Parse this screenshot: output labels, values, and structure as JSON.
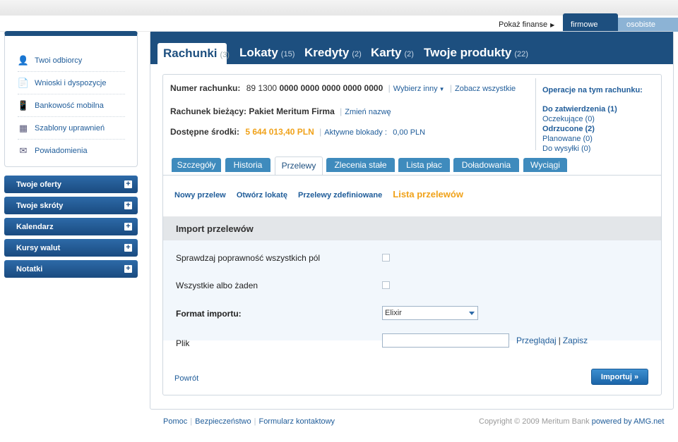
{
  "header": {
    "show_finance": "Pokaż finanse",
    "tab_business": "firmowe",
    "tab_private": "osobiste"
  },
  "sidebar": {
    "items": [
      {
        "label": "Twoi odbiorcy",
        "icon": "person-icon"
      },
      {
        "label": "Wnioski i dyspozycje",
        "icon": "document-icon"
      },
      {
        "label": "Bankowość mobilna",
        "icon": "mobile-phone-icon"
      },
      {
        "label": "Szablony uprawnień",
        "icon": "org-chart-icon"
      },
      {
        "label": "Powiadomienia",
        "icon": "notification-icon"
      }
    ],
    "accordions": [
      {
        "label": "Twoje oferty"
      },
      {
        "label": "Twoje skróty"
      },
      {
        "label": "Kalendarz"
      },
      {
        "label": "Kursy walut"
      },
      {
        "label": "Notatki"
      }
    ]
  },
  "main_tabs": [
    {
      "label": "Rachunki",
      "count": "(3)"
    },
    {
      "label": "Lokaty",
      "count": "(15)"
    },
    {
      "label": "Kredyty",
      "count": "(2)"
    },
    {
      "label": "Karty",
      "count": "(2)"
    },
    {
      "label": "Twoje produkty",
      "count": "(22)"
    }
  ],
  "account": {
    "number_label": "Numer rachunku:",
    "number_prefix": "89 1300",
    "number_rest": "0000 0000 0000 0000 0000",
    "choose_other": "Wybierz inny",
    "see_all": "Zobacz wszystkie",
    "type_label": "Rachunek bieżący: Pakiet Meritum Firma",
    "rename": "Zmień nazwę",
    "funds_label": "Dostępne środki:",
    "funds_value": "5 644 013,40 PLN",
    "blocks_label": "Aktywne blokady :",
    "blocks_value": "0,00 PLN"
  },
  "operations": {
    "title": "Operacje na tym rachunku:",
    "items": [
      {
        "label": "Do zatwierdzenia (1)",
        "bold": true
      },
      {
        "label": "Oczekujące (0)",
        "bold": false
      },
      {
        "label": "Odrzucone (2)",
        "bold": true
      },
      {
        "label": "Planowane (0)",
        "bold": false
      },
      {
        "label": "Do wysyłki (0)",
        "bold": false
      }
    ]
  },
  "subtabs": [
    "Szczegóły",
    "Historia",
    "Przelewy",
    "Zlecenia stałe",
    "Lista płac",
    "Doładowania",
    "Wyciągi"
  ],
  "actions": [
    "Nowy przelew",
    "Otwórz lokatę",
    "Przelewy zdefiniowane",
    "Lista przelewów"
  ],
  "import": {
    "title": "Import przelewów",
    "check_all": "Sprawdzaj poprawność wszystkich pól",
    "all_or_none": "Wszystkie albo żaden",
    "format_label": "Format importu:",
    "format_value": "Elixir",
    "file_label": "Plik",
    "browse": "Przeglądaj",
    "pipe": "|",
    "save": "Zapisz",
    "back": "Powrót",
    "import_btn": "Importuj »"
  },
  "footer": {
    "help": "Pomoc",
    "security": "Bezpieczeństwo",
    "contact": "Formularz kontaktowy",
    "copyright": "Copyright © 2009 Meritum Bank",
    "powered": "powered by AMG.net"
  }
}
